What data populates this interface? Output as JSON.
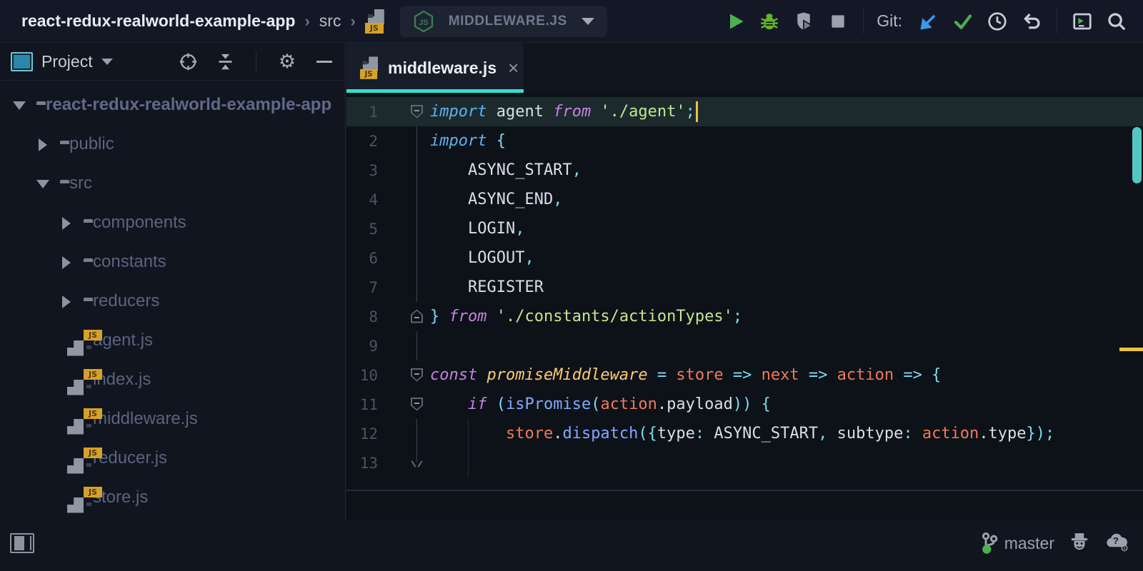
{
  "colors": {
    "accent_cyan": "#2fe0cf",
    "caret_yellow": "#f0c243",
    "scrollbar_thumb": "#54c7c2",
    "run_green": "#4caf50",
    "debug_green": "#62b524",
    "git_update_blue": "#3a9ae8",
    "js_badge_amber": "#d7a129"
  },
  "topbar": {
    "breadcrumbs": {
      "project": "react-redux-realworld-example-app",
      "chevron": "›",
      "folder": "src"
    },
    "run_widget": {
      "config_name": "MIDDLEWARE.JS"
    },
    "git_label": "Git:"
  },
  "sidebar": {
    "header": {
      "title": "Project"
    },
    "tree": [
      {
        "level": 0,
        "arrow": "open",
        "kind": "folder",
        "label": "react-redux-realworld-example-app",
        "bold": true
      },
      {
        "level": 1,
        "arrow": "closed",
        "kind": "folder",
        "label": "public"
      },
      {
        "level": 1,
        "arrow": "open",
        "kind": "folder",
        "label": "src"
      },
      {
        "level": 2,
        "arrow": "closed",
        "kind": "folder",
        "label": "components"
      },
      {
        "level": 2,
        "arrow": "closed",
        "kind": "folder",
        "label": "constants"
      },
      {
        "level": 2,
        "arrow": "closed",
        "kind": "folder",
        "label": "reducers"
      },
      {
        "level": 2,
        "arrow": "none",
        "kind": "js",
        "label": "agent.js"
      },
      {
        "level": 2,
        "arrow": "none",
        "kind": "js",
        "label": "index.js"
      },
      {
        "level": 2,
        "arrow": "none",
        "kind": "js",
        "label": "middleware.js"
      },
      {
        "level": 2,
        "arrow": "none",
        "kind": "js",
        "label": "reducer.js"
      },
      {
        "level": 2,
        "arrow": "none",
        "kind": "js",
        "label": "store.js"
      }
    ]
  },
  "editor": {
    "tab": {
      "label": "middleware.js",
      "close_glyph": "×"
    },
    "code_lines": [
      {
        "n": 1,
        "current": true,
        "cursor": true,
        "fold": "open",
        "fline": false,
        "tokens": [
          [
            "k1",
            "import"
          ],
          [
            "d",
            " agent "
          ],
          [
            "k2",
            "from"
          ],
          [
            "d",
            " "
          ],
          [
            "s",
            "'./agent'"
          ],
          [
            "p",
            ";"
          ]
        ]
      },
      {
        "n": 2,
        "fold": null,
        "fline": true,
        "tokens": [
          [
            "k1",
            "import"
          ],
          [
            "d",
            " "
          ],
          [
            "p",
            "{"
          ]
        ]
      },
      {
        "n": 3,
        "fold": null,
        "fline": true,
        "tokens": [
          [
            "d",
            "    ASYNC_START"
          ],
          [
            "p",
            ","
          ]
        ]
      },
      {
        "n": 4,
        "fold": null,
        "fline": true,
        "tokens": [
          [
            "d",
            "    ASYNC_END"
          ],
          [
            "p",
            ","
          ]
        ]
      },
      {
        "n": 5,
        "fold": null,
        "fline": true,
        "tokens": [
          [
            "d",
            "    LOGIN"
          ],
          [
            "p",
            ","
          ]
        ]
      },
      {
        "n": 6,
        "fold": null,
        "fline": true,
        "tokens": [
          [
            "d",
            "    LOGOUT"
          ],
          [
            "p",
            ","
          ]
        ]
      },
      {
        "n": 7,
        "fold": null,
        "fline": true,
        "tokens": [
          [
            "d",
            "    REGISTER"
          ]
        ]
      },
      {
        "n": 8,
        "fold": "close",
        "fline": false,
        "tokens": [
          [
            "p",
            "}"
          ],
          [
            "d",
            " "
          ],
          [
            "k2",
            "from"
          ],
          [
            "d",
            " "
          ],
          [
            "s",
            "'./constants/actionTypes'"
          ],
          [
            "p",
            ";"
          ]
        ]
      },
      {
        "n": 9,
        "fold": null,
        "fline": true,
        "tokens": []
      },
      {
        "n": 10,
        "fold": "open",
        "fline": false,
        "tokens": [
          [
            "k2",
            "const"
          ],
          [
            "d",
            " "
          ],
          [
            "y",
            "promiseMiddleware"
          ],
          [
            "d",
            " "
          ],
          [
            "p",
            "="
          ],
          [
            "d",
            " "
          ],
          [
            "a",
            "store"
          ],
          [
            "d",
            " "
          ],
          [
            "p",
            "=>"
          ],
          [
            "d",
            " "
          ],
          [
            "a",
            "next"
          ],
          [
            "d",
            " "
          ],
          [
            "p",
            "=>"
          ],
          [
            "d",
            " "
          ],
          [
            "a",
            "action"
          ],
          [
            "d",
            " "
          ],
          [
            "p",
            "=>"
          ],
          [
            "d",
            " "
          ],
          [
            "p",
            "{"
          ]
        ]
      },
      {
        "n": 11,
        "fold": "open",
        "fline": false,
        "tokens": [
          [
            "d",
            "    "
          ],
          [
            "k2",
            "if"
          ],
          [
            "d",
            " "
          ],
          [
            "p",
            "("
          ],
          [
            "f",
            "isPromise"
          ],
          [
            "p",
            "("
          ],
          [
            "a",
            "action"
          ],
          [
            "d",
            ".payload"
          ],
          [
            "p",
            "))"
          ],
          [
            "d",
            " "
          ],
          [
            "p",
            "{"
          ]
        ]
      },
      {
        "n": 12,
        "fold": null,
        "fline": true,
        "guides": [
          4
        ],
        "tokens": [
          [
            "d",
            "        "
          ],
          [
            "a",
            "store"
          ],
          [
            "d",
            "."
          ],
          [
            "f",
            "dispatch"
          ],
          [
            "p",
            "({"
          ],
          [
            "d",
            "type"
          ],
          [
            "p",
            ":"
          ],
          [
            "d",
            " ASYNC_START"
          ],
          [
            "p",
            ","
          ],
          [
            "d",
            " subtype"
          ],
          [
            "p",
            ":"
          ],
          [
            "d",
            " "
          ],
          [
            "a",
            "action"
          ],
          [
            "d",
            ".type"
          ],
          [
            "p",
            "});"
          ]
        ]
      },
      {
        "n": 13,
        "fold": "vend",
        "fline": false,
        "guides": [
          4
        ],
        "tokens": []
      }
    ]
  },
  "statusbar": {
    "branch": "master"
  }
}
